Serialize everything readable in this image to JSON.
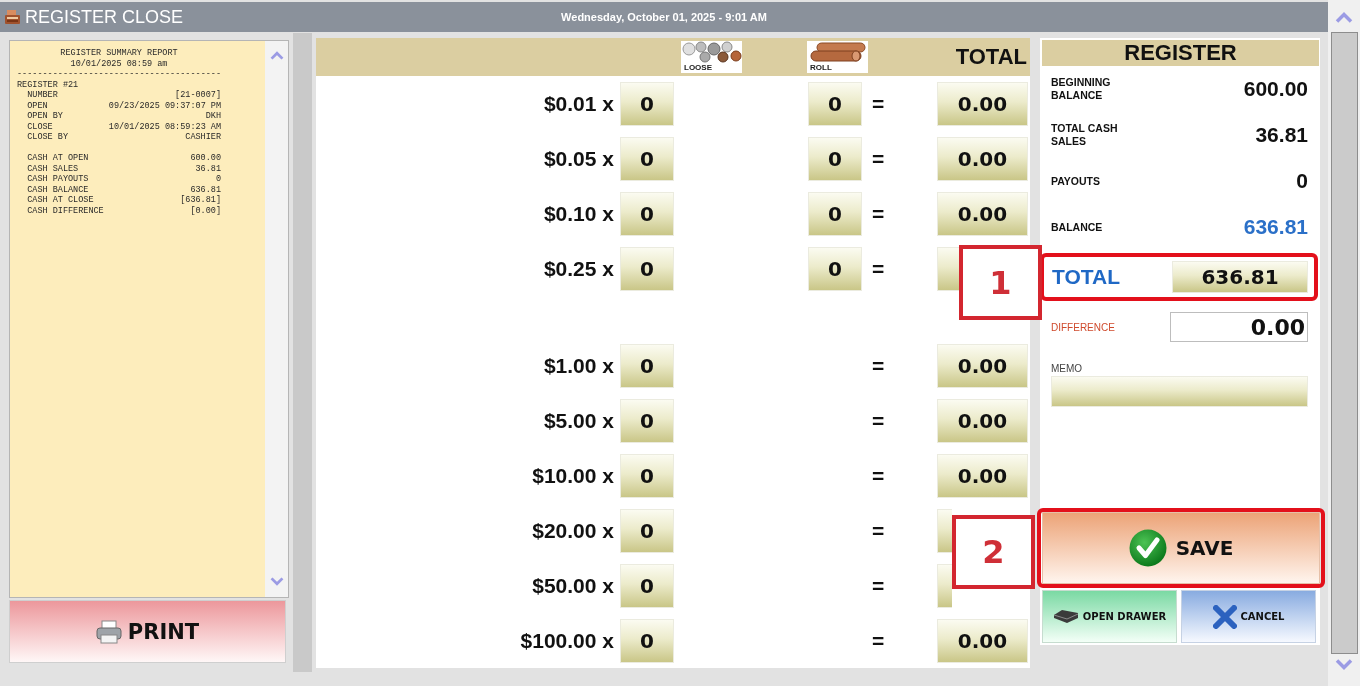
{
  "window": {
    "title": "REGISTER CLOSE",
    "datetime": "Wednesday, October 01, 2025 - 9:01 AM"
  },
  "receipt": {
    "title": "REGISTER SUMMARY REPORT",
    "timestamp": "10/01/2025 08:59 am",
    "rule": "----------------------------------------",
    "section": "REGISTER #21",
    "groups": [
      [
        {
          "label": "NUMBER",
          "value": "[21-0007]"
        },
        {
          "label": "OPEN",
          "value": "09/23/2025 09:37:07 PM"
        },
        {
          "label": "OPEN BY",
          "value": "DKH"
        },
        {
          "label": "CLOSE",
          "value": "10/01/2025 08:59:23 AM"
        },
        {
          "label": "CLOSE BY",
          "value": "CASHIER"
        }
      ],
      [
        {
          "label": "CASH AT OPEN",
          "value": "600.00"
        },
        {
          "label": "CASH SALES",
          "value": "36.81"
        },
        {
          "label": "CASH PAYOUTS",
          "value": "0"
        },
        {
          "label": "CASH BALANCE",
          "value": "636.81"
        },
        {
          "label": "CASH AT CLOSE",
          "value": "[636.81]"
        },
        {
          "label": "CASH DIFFERENCE",
          "value": "[0.00]"
        }
      ]
    ]
  },
  "print_button": {
    "label": "PRINT"
  },
  "count": {
    "columns": {
      "loose": "LOOSE",
      "roll": "ROLL",
      "total": "TOTAL"
    },
    "coins": [
      {
        "denomination": "$0.01 x",
        "loose": "0",
        "roll": "0",
        "operator": "=",
        "total": "0.00"
      },
      {
        "denomination": "$0.05 x",
        "loose": "0",
        "roll": "0",
        "operator": "=",
        "total": "0.00"
      },
      {
        "denomination": "$0.10 x",
        "loose": "0",
        "roll": "0",
        "operator": "=",
        "total": "0.00"
      },
      {
        "denomination": "$0.25 x",
        "loose": "0",
        "roll": "0",
        "operator": "="
      }
    ],
    "bills": [
      {
        "denomination": "$1.00 x",
        "loose": "0",
        "operator": "=",
        "total": "0.00"
      },
      {
        "denomination": "$5.00 x",
        "loose": "0",
        "operator": "=",
        "total": "0.00"
      },
      {
        "denomination": "$10.00 x",
        "loose": "0",
        "operator": "=",
        "total": "0.00"
      },
      {
        "denomination": "$20.00 x",
        "loose": "0",
        "operator": "="
      },
      {
        "denomination": "$50.00 x",
        "loose": "0",
        "operator": "="
      },
      {
        "denomination": "$100.00 x",
        "loose": "0",
        "operator": "=",
        "total": "0.00"
      }
    ]
  },
  "register": {
    "title": "REGISTER",
    "summary": [
      {
        "label": "BEGINNING BALANCE",
        "value": "600.00",
        "kind": "amount"
      },
      {
        "label": "TOTAL CASH SALES",
        "value": "36.81",
        "kind": "amount"
      },
      {
        "label": "PAYOUTS",
        "value": "0",
        "kind": "amount"
      },
      {
        "label": "BALANCE",
        "value": "636.81",
        "kind": "balance"
      }
    ],
    "total": {
      "label": "TOTAL",
      "value": "636.81",
      "highlighted": true,
      "callout": "1"
    },
    "difference": {
      "label": "DIFFERENCE",
      "value": "0.00"
    },
    "memo": {
      "label": "MEMO"
    }
  },
  "save_button": {
    "label": "SAVE",
    "highlighted": true,
    "callout": "2"
  },
  "actions": [
    {
      "kind": "open_drawer",
      "label": "OPEN DRAWER"
    },
    {
      "kind": "cancel",
      "label": "CANCEL"
    }
  ]
}
